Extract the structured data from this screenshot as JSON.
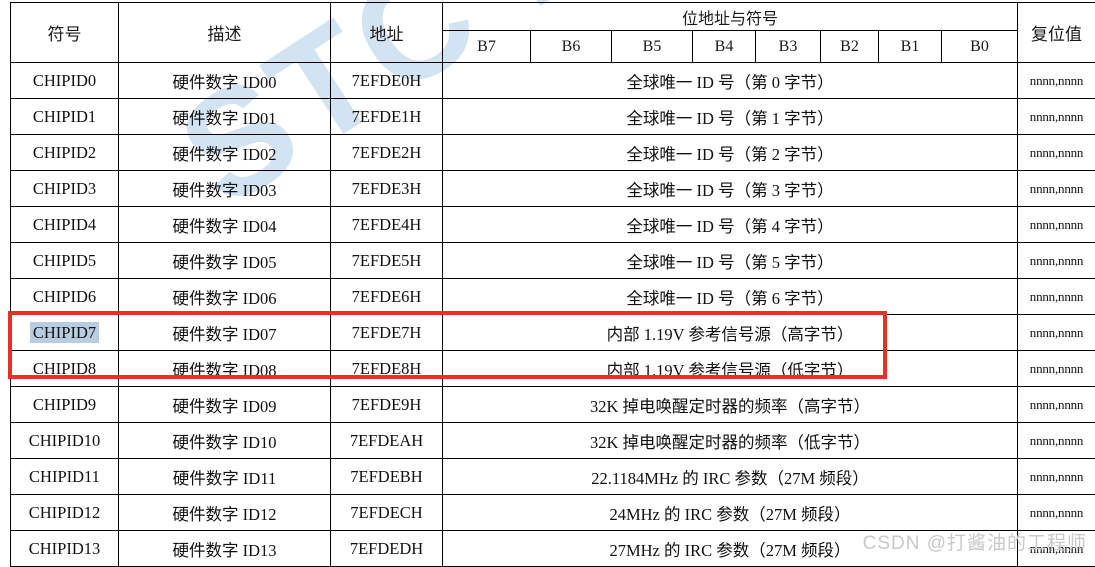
{
  "table": {
    "headers": {
      "symbol": "符号",
      "description": "描述",
      "address": "地址",
      "bit_group": "位地址与符号",
      "reset_value": "复位值",
      "bits": [
        "B7",
        "B6",
        "B5",
        "B4",
        "B3",
        "B2",
        "B1",
        "B0"
      ]
    },
    "rows": [
      {
        "symbol": "CHIPID0",
        "description": "硬件数字 ID00",
        "address": "7EFDE0H",
        "bit_desc": "全球唯一 ID 号（第 0 字节）",
        "reset": "nnnn,nnnn",
        "highlighted": false,
        "selected": false
      },
      {
        "symbol": "CHIPID1",
        "description": "硬件数字 ID01",
        "address": "7EFDE1H",
        "bit_desc": "全球唯一 ID 号（第 1 字节）",
        "reset": "nnnn,nnnn",
        "highlighted": false,
        "selected": false
      },
      {
        "symbol": "CHIPID2",
        "description": "硬件数字 ID02",
        "address": "7EFDE2H",
        "bit_desc": "全球唯一 ID 号（第 2 字节）",
        "reset": "nnnn,nnnn",
        "highlighted": false,
        "selected": false
      },
      {
        "symbol": "CHIPID3",
        "description": "硬件数字 ID03",
        "address": "7EFDE3H",
        "bit_desc": "全球唯一 ID 号（第 3 字节）",
        "reset": "nnnn,nnnn",
        "highlighted": false,
        "selected": false
      },
      {
        "symbol": "CHIPID4",
        "description": "硬件数字 ID04",
        "address": "7EFDE4H",
        "bit_desc": "全球唯一 ID 号（第 4 字节）",
        "reset": "nnnn,nnnn",
        "highlighted": false,
        "selected": false
      },
      {
        "symbol": "CHIPID5",
        "description": "硬件数字 ID05",
        "address": "7EFDE5H",
        "bit_desc": "全球唯一 ID 号（第 5 字节）",
        "reset": "nnnn,nnnn",
        "highlighted": false,
        "selected": false
      },
      {
        "symbol": "CHIPID6",
        "description": "硬件数字 ID06",
        "address": "7EFDE6H",
        "bit_desc": "全球唯一 ID 号（第 6 字节）",
        "reset": "nnnn,nnnn",
        "highlighted": false,
        "selected": false
      },
      {
        "symbol": "CHIPID7",
        "description": "硬件数字 ID07",
        "address": "7EFDE7H",
        "bit_desc": "内部 1.19V 参考信号源（高字节）",
        "reset": "nnnn,nnnn",
        "highlighted": true,
        "selected": true
      },
      {
        "symbol": "CHIPID8",
        "description": "硬件数字 ID08",
        "address": "7EFDE8H",
        "bit_desc": "内部 1.19V 参考信号源（低字节）",
        "reset": "nnnn,nnnn",
        "highlighted": true,
        "selected": false
      },
      {
        "symbol": "CHIPID9",
        "description": "硬件数字 ID09",
        "address": "7EFDE9H",
        "bit_desc": "32K 掉电唤醒定时器的频率（高字节）",
        "reset": "nnnn,nnnn",
        "highlighted": false,
        "selected": false
      },
      {
        "symbol": "CHIPID10",
        "description": "硬件数字 ID10",
        "address": "7EFDEAH",
        "bit_desc": "32K 掉电唤醒定时器的频率（低字节）",
        "reset": "nnnn,nnnn",
        "highlighted": false,
        "selected": false
      },
      {
        "symbol": "CHIPID11",
        "description": "硬件数字 ID11",
        "address": "7EFDEBH",
        "bit_desc": "22.1184MHz 的 IRC 参数（27M 频段）",
        "reset": "nnnn,nnnn",
        "highlighted": false,
        "selected": false
      },
      {
        "symbol": "CHIPID12",
        "description": "硬件数字 ID12",
        "address": "7EFDECH",
        "bit_desc": "24MHz 的 IRC 参数（27M 频段）",
        "reset": "nnnn,nnnn",
        "highlighted": false,
        "selected": false
      },
      {
        "symbol": "CHIPID13",
        "description": "硬件数字 ID13",
        "address": "7EFDEDH",
        "bit_desc": "27MHz 的 IRC 参数（27M 频段）",
        "reset": "nnnn,nnnn",
        "highlighted": false,
        "selected": false
      }
    ]
  },
  "watermarks": {
    "background": "STC MCU",
    "author": "CSDN @打酱油的工程师"
  },
  "colors": {
    "header_background": "#c6d5ea",
    "annotation_box": "#e8302b",
    "selection": "#b9cde0",
    "watermark_background": "#d2e3f2",
    "watermark_author": "#c9c9c9",
    "border": "#000000"
  }
}
